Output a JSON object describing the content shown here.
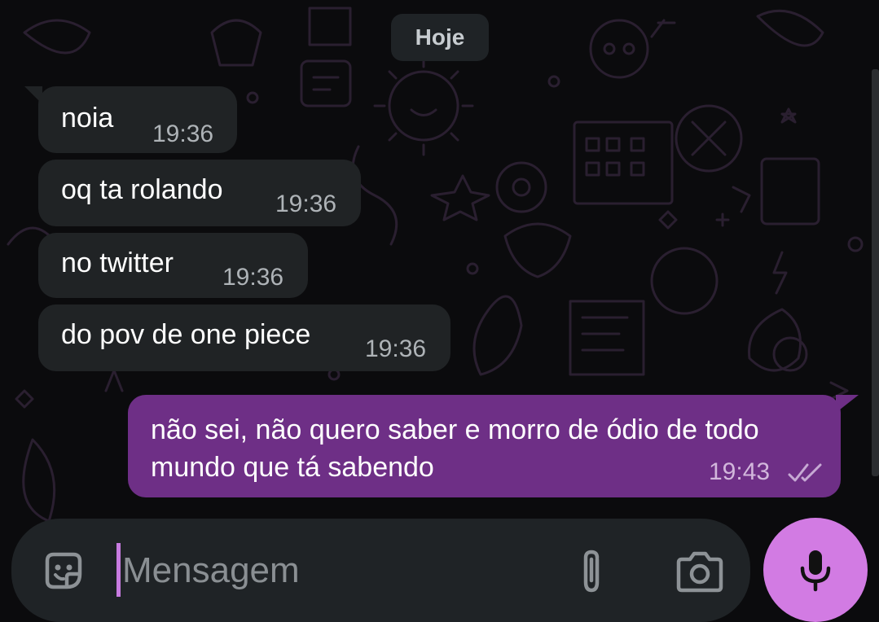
{
  "chat": {
    "date_separator": "Hoje",
    "messages": [
      {
        "direction": "incoming",
        "text": "noia",
        "time": "19:36"
      },
      {
        "direction": "incoming",
        "text": "oq ta rolando",
        "time": "19:36"
      },
      {
        "direction": "incoming",
        "text": "no twitter",
        "time": "19:36"
      },
      {
        "direction": "incoming",
        "text": "do pov de one piece",
        "time": "19:36"
      },
      {
        "direction": "outgoing",
        "text": "não sei, não quero saber e morro de ódio de todo mundo que tá sabendo",
        "time": "19:43",
        "status": "delivered-double-check"
      }
    ]
  },
  "composer": {
    "placeholder": "Mensagem",
    "value": "",
    "icons": {
      "emoji": "sticker-smile-icon",
      "attach": "paperclip-icon",
      "camera": "camera-icon",
      "send": "microphone-icon"
    }
  },
  "colors": {
    "background": "#0b0b0d",
    "incoming_bubble": "#202325",
    "outgoing_bubble": "#6e2f86",
    "accent": "#d27be3",
    "composer": "#1f2326"
  }
}
